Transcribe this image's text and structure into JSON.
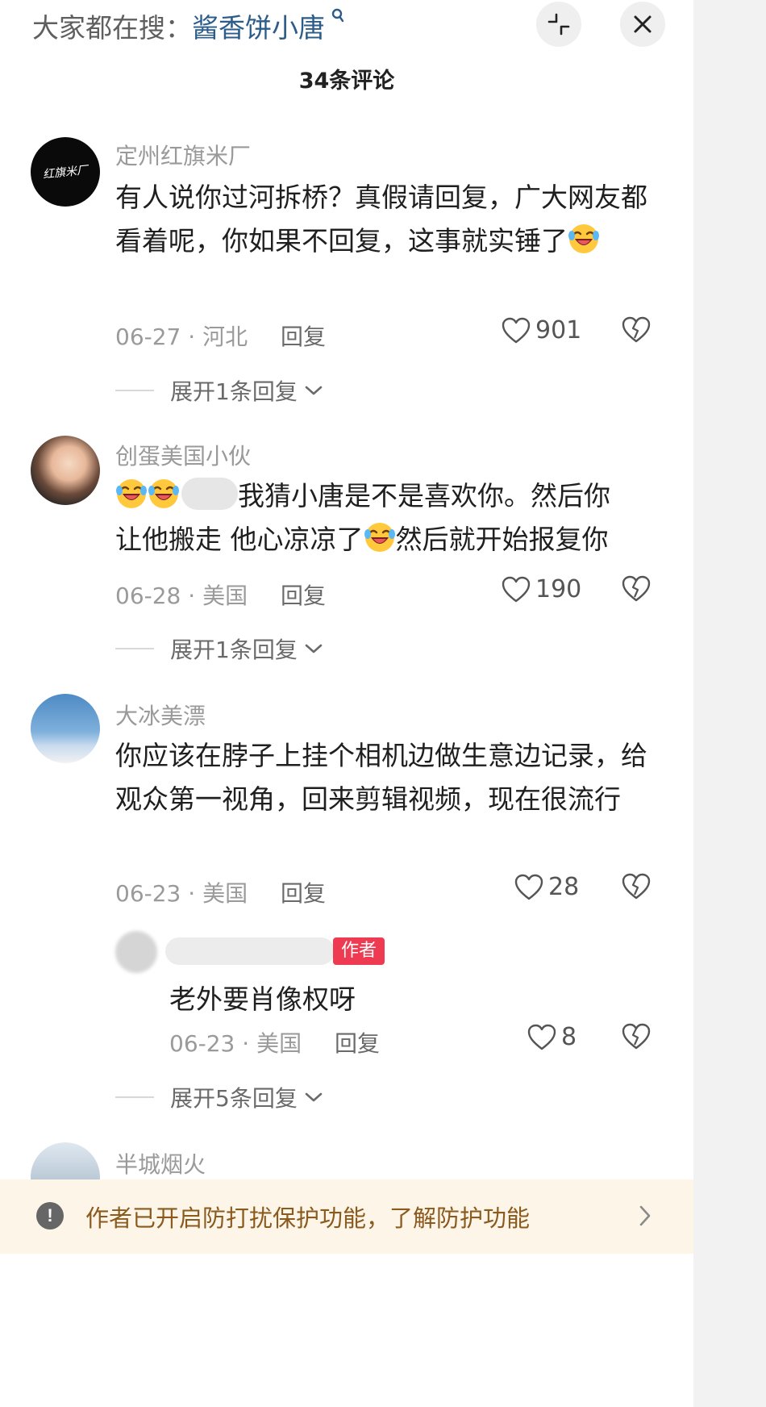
{
  "header": {
    "search_prefix": "大家都在搜：",
    "search_term": "酱香饼小唐",
    "comment_count": "34条评论",
    "collapse_icon": "collapse-icon",
    "close_icon": "close-icon"
  },
  "comments": [
    {
      "username": "定州红旗米厂",
      "text": "有人说你过河拆桥？真假请回复，广大网友都看着呢，你如果不回复，这事就实锤了",
      "date": "06-27",
      "location": "河北",
      "reply_label": "回复",
      "likes": "901",
      "expand_label": "展开1条回复"
    },
    {
      "username": "创蛋美国小伙",
      "text_part1": "我猜小唐是不是喜欢你。然后你",
      "text_part2": "让他搬走 他心凉凉了",
      "text_part3": "然后就开始报复你",
      "date": "06-28",
      "location": "美国",
      "reply_label": "回复",
      "likes": "190",
      "expand_label": "展开1条回复"
    },
    {
      "username": "大冰美漂",
      "text": "你应该在脖子上挂个相机边做生意边记录，给观众第一视角，回来剪辑视频，现在很流行",
      "date": "06-23",
      "location": "美国",
      "reply_label": "回复",
      "likes": "28",
      "sub_reply": {
        "badge": "作者",
        "text": "老外要肖像权呀",
        "date": "06-23",
        "location": "美国",
        "reply_label": "回复",
        "likes": "8"
      },
      "expand_label": "展开5条回复"
    },
    {
      "username": "半城烟火"
    }
  ],
  "notice": {
    "text": "作者已开启防打扰保护功能，了解防护功能",
    "icon": "warning-icon"
  },
  "avatar_text_1": "红旗米厂"
}
